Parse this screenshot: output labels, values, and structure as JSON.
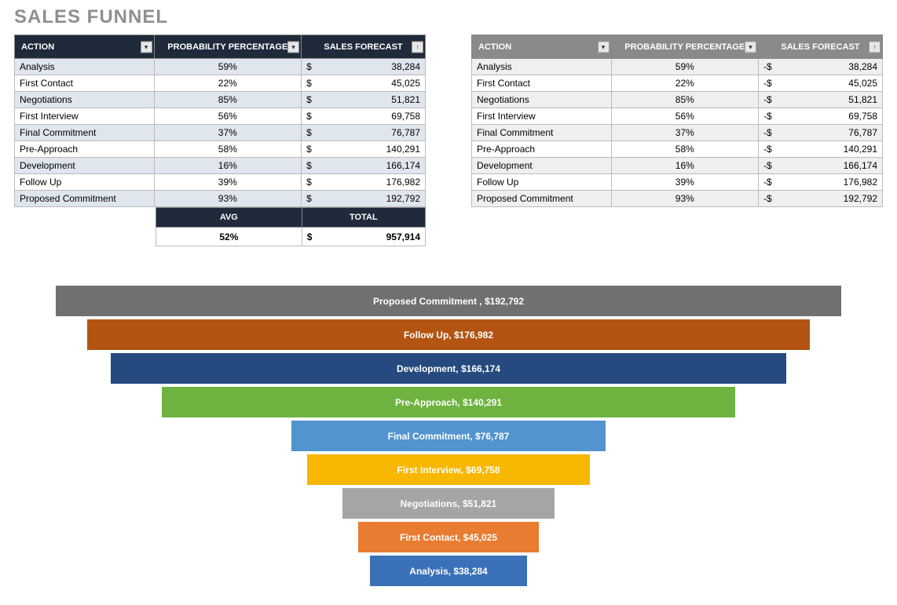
{
  "title": "SALES FUNNEL",
  "columns": {
    "action": "ACTION",
    "prob": "PROBABILITY PERCENTAGE",
    "forecast": "SALES FORECAST"
  },
  "rows": [
    {
      "action": "Analysis",
      "prob": "59%",
      "forecast": "38,284"
    },
    {
      "action": "First Contact",
      "prob": "22%",
      "forecast": "45,025"
    },
    {
      "action": "Negotiations",
      "prob": "85%",
      "forecast": "51,821"
    },
    {
      "action": "First Interview",
      "prob": "56%",
      "forecast": "69,758"
    },
    {
      "action": "Final Commitment",
      "prob": "37%",
      "forecast": "76,787"
    },
    {
      "action": "Pre-Approach",
      "prob": "58%",
      "forecast": "140,291"
    },
    {
      "action": "Development",
      "prob": "16%",
      "forecast": "166,174"
    },
    {
      "action": "Follow Up",
      "prob": "39%",
      "forecast": "176,982"
    },
    {
      "action": "Proposed Commitment",
      "prob": "93%",
      "forecast": "192,792"
    }
  ],
  "left_currency": "$",
  "right_currency": "-$",
  "summary": {
    "avg_label": "AVG",
    "total_label": "TOTAL",
    "avg": "52%",
    "total": "957,914"
  },
  "chart_data": {
    "type": "bar",
    "title": "",
    "orientation": "funnel",
    "series": [
      {
        "name": "Proposed Commitment",
        "value": 192792,
        "label": "Proposed Commitment ,  $192,792",
        "color": "#707070",
        "width_pct": 100
      },
      {
        "name": "Follow Up",
        "value": 176982,
        "label": "Follow Up,  $176,982",
        "color": "#b35413",
        "width_pct": 92
      },
      {
        "name": "Development",
        "value": 166174,
        "label": "Development,  $166,174",
        "color": "#254a7f",
        "width_pct": 86
      },
      {
        "name": "Pre-Approach",
        "value": 140291,
        "label": "Pre-Approach,  $140,291",
        "color": "#6eb33f",
        "width_pct": 73
      },
      {
        "name": "Final Commitment",
        "value": 76787,
        "label": "Final Commitment,  $76,787",
        "color": "#5294cf",
        "width_pct": 40
      },
      {
        "name": "First Interview",
        "value": 69758,
        "label": "First Interview,  $69,758",
        "color": "#f8b700",
        "width_pct": 36
      },
      {
        "name": "Negotiations",
        "value": 51821,
        "label": "Negotiations,  $51,821",
        "color": "#a5a5a5",
        "width_pct": 27
      },
      {
        "name": "First Contact",
        "value": 45025,
        "label": "First Contact,  $45,025",
        "color": "#e87c31",
        "width_pct": 23
      },
      {
        "name": "Analysis",
        "value": 38284,
        "label": "Analysis,  $38,284",
        "color": "#3b71b8",
        "width_pct": 20
      }
    ]
  }
}
